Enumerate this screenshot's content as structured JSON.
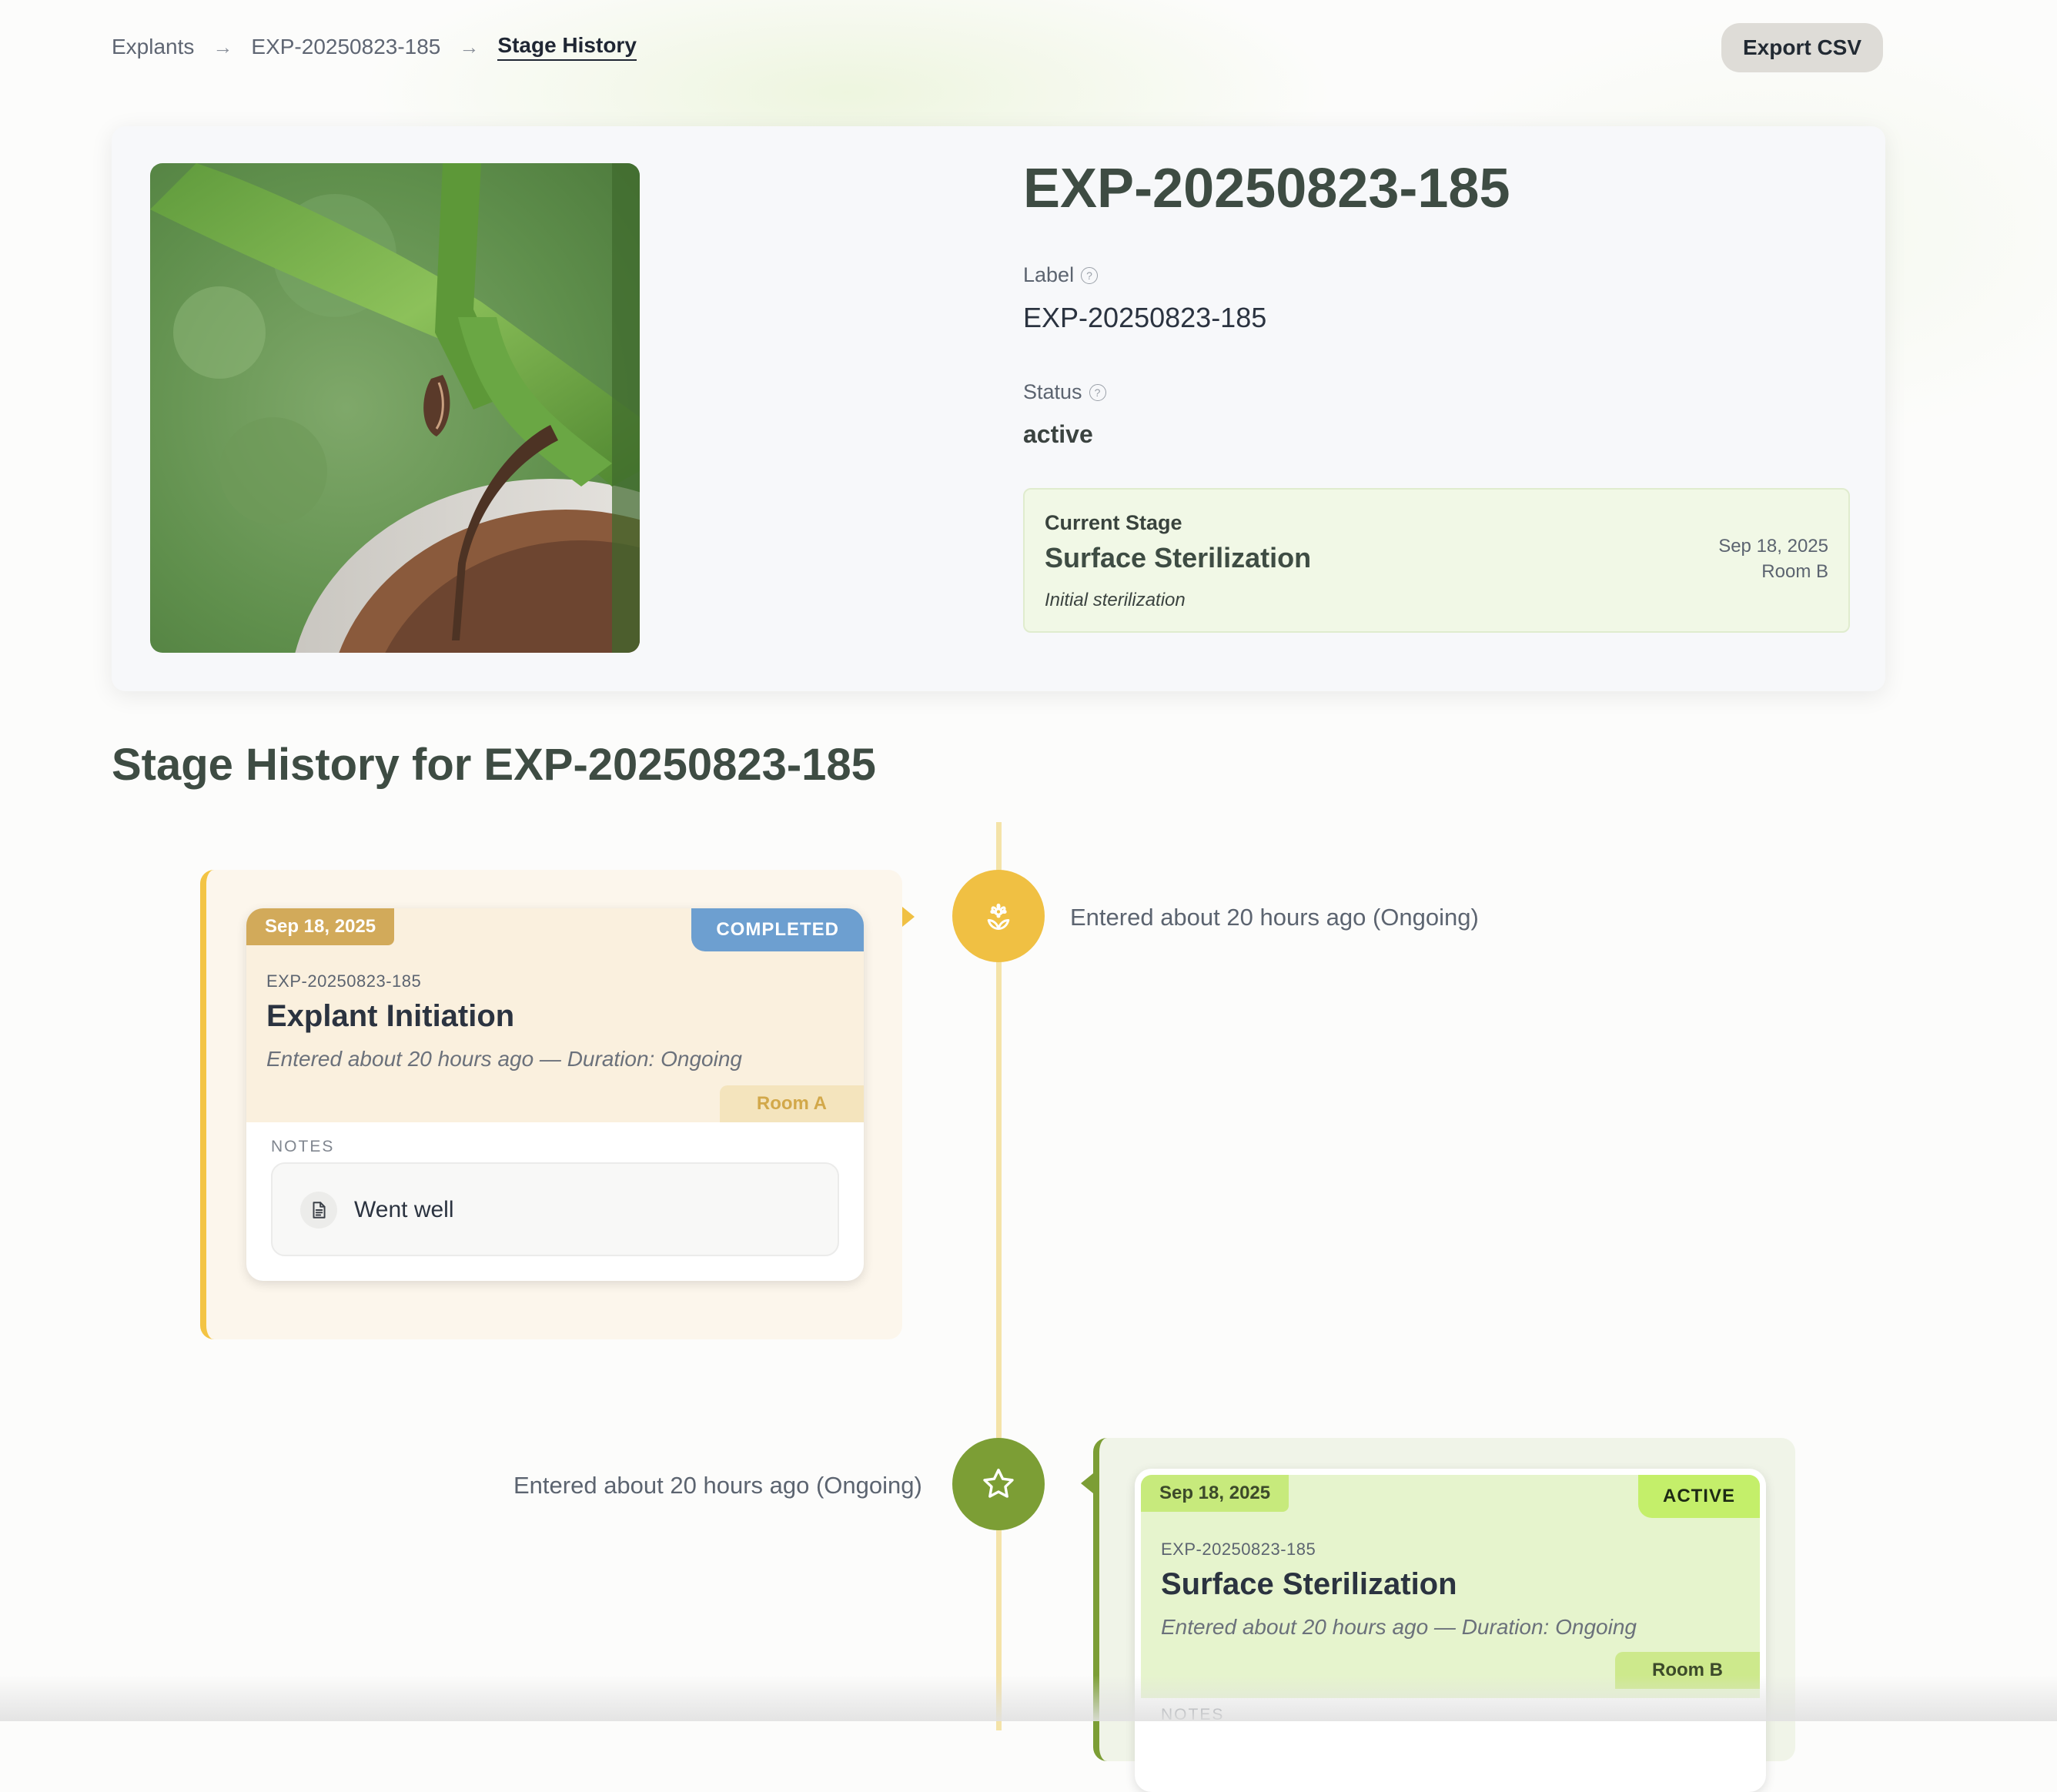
{
  "breadcrumb": {
    "items": [
      "Explants",
      "EXP-20250823-185"
    ],
    "separator": "→",
    "current": "Stage History"
  },
  "actions": {
    "export_label": "Export CSV"
  },
  "explant": {
    "title": "EXP-20250823-185",
    "label_caption": "Label",
    "label_value": "EXP-20250823-185",
    "status_caption": "Status",
    "status_value": "active",
    "help_glyph": "?",
    "current_stage": {
      "caption": "Current Stage",
      "name": "Surface Sterilization",
      "note": "Initial sterilization",
      "date": "Sep 18, 2025",
      "room": "Room B"
    }
  },
  "history": {
    "heading": "Stage History for EXP-20250823-185",
    "entries": [
      {
        "timeline_text": "Entered about 20 hours ago (Ongoing)",
        "date": "Sep 18, 2025",
        "status": "COMPLETED",
        "explant_id": "EXP-20250823-185",
        "stage": "Explant Initiation",
        "meta": "Entered about 20 hours ago — Duration: Ongoing",
        "room": "Room A",
        "notes_label": "NOTES",
        "note": "Went well",
        "icon": "flower-icon"
      },
      {
        "timeline_text": "Entered about 20 hours ago (Ongoing)",
        "date": "Sep 18, 2025",
        "status": "ACTIVE",
        "explant_id": "EXP-20250823-185",
        "stage": "Surface Sterilization",
        "meta": "Entered about 20 hours ago — Duration: Ongoing",
        "room": "Room B",
        "notes_label": "NOTES",
        "icon": "star-icon"
      }
    ]
  },
  "colors": {
    "accent_dark_green": "#3e4c43",
    "completed_blue": "#6d9fd0",
    "active_green": "#c4ef6a",
    "timeline_yellow": "#f0c043",
    "timeline_green": "#7c9e35"
  }
}
